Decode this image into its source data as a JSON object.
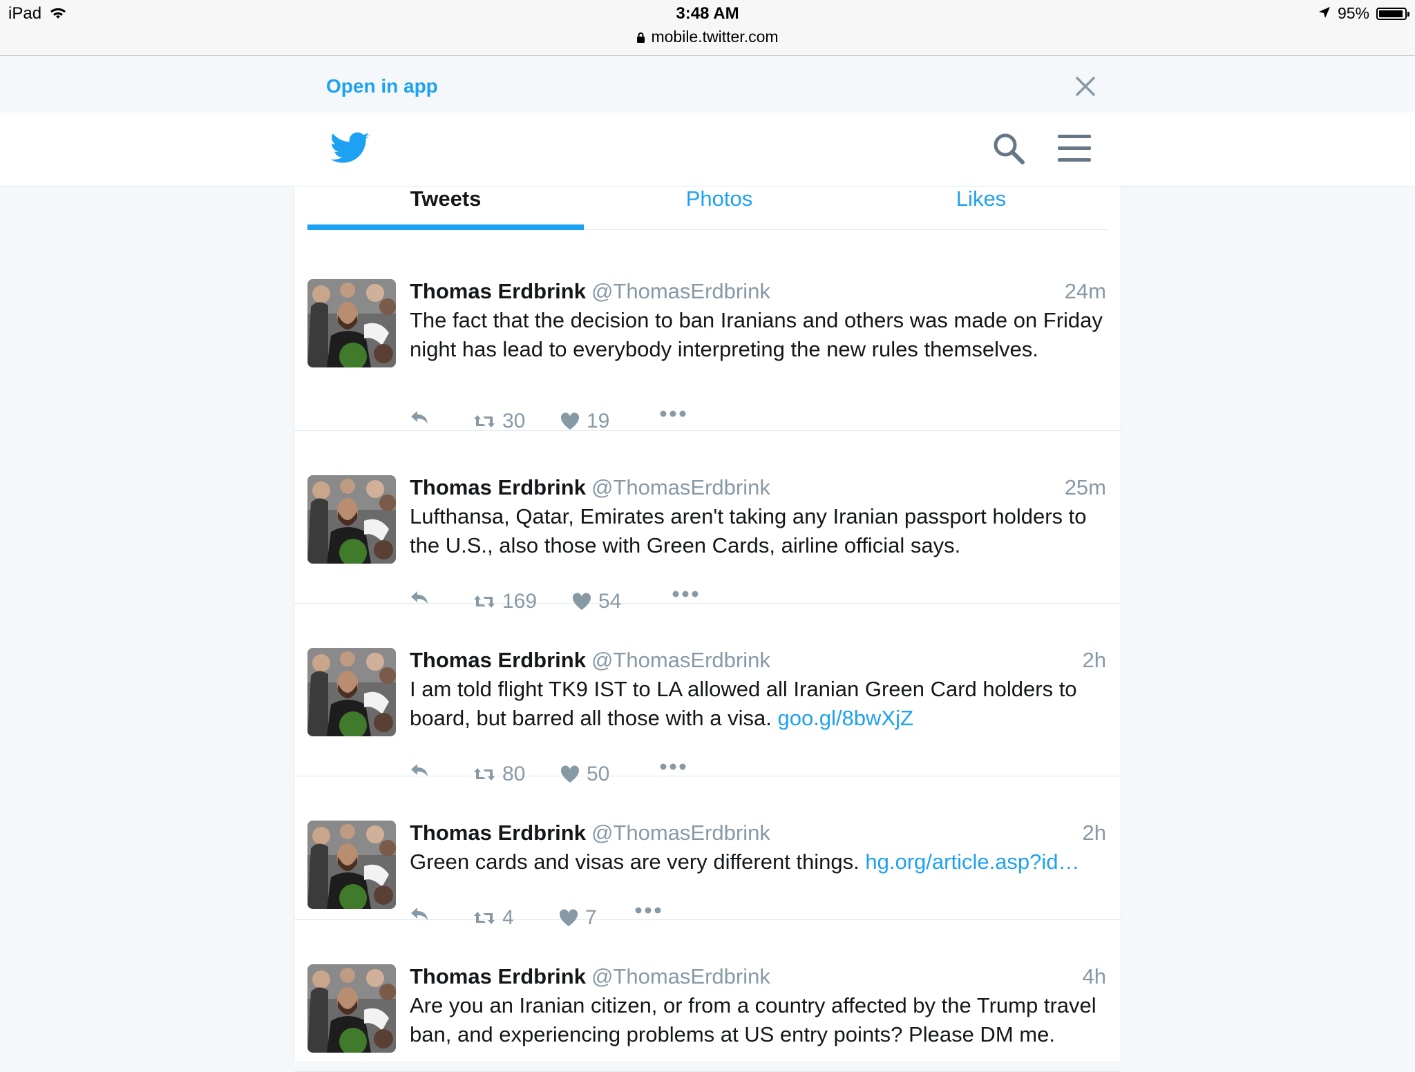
{
  "status_bar": {
    "device": "iPad",
    "time": "3:48 AM",
    "url": "mobile.twitter.com",
    "battery": "95%",
    "battery_level": 0.95
  },
  "banner": {
    "open_in_app": "Open in app"
  },
  "tabs": [
    {
      "label": "Tweets",
      "active": true
    },
    {
      "label": "Photos",
      "active": false
    },
    {
      "label": "Likes",
      "active": false
    }
  ],
  "tweets": [
    {
      "name": "Thomas Erdbrink",
      "handle": "@ThomasErdbrink",
      "time": "24m",
      "text": "The fact that the decision to ban Iranians and others was made on Friday night has lead to everybody interpreting the new rules themselves.",
      "link": "",
      "retweets": "30",
      "likes": "19"
    },
    {
      "name": "Thomas Erdbrink",
      "handle": "@ThomasErdbrink",
      "time": "25m",
      "text": "Lufthansa, Qatar, Emirates aren't taking any Iranian passport holders to the U.S., also those with Green Cards, airline official says.",
      "link": "",
      "retweets": "169",
      "likes": "54"
    },
    {
      "name": "Thomas Erdbrink",
      "handle": "@ThomasErdbrink",
      "time": "2h",
      "text": "I am told flight TK9 IST to LA allowed all Iranian Green Card holders to board, but barred all those with a visa. ",
      "link": "goo.gl/8bwXjZ",
      "retweets": "80",
      "likes": "50"
    },
    {
      "name": "Thomas Erdbrink",
      "handle": "@ThomasErdbrink",
      "time": "2h",
      "text": "Green cards and visas are very different things. ",
      "link": "hg.org/article.asp?id…",
      "retweets": "4",
      "likes": "7"
    },
    {
      "name": "Thomas Erdbrink",
      "handle": "@ThomasErdbrink",
      "time": "4h",
      "text": "Are you an Iranian citizen, or from a country affected by the Trump travel ban, and experiencing problems at US entry points? Please DM me.",
      "link": "",
      "retweets": "",
      "likes": ""
    }
  ],
  "colors": {
    "brand": "#1da1f2",
    "muted": "#8899a6",
    "text": "#14171a",
    "border": "#e1e8ed",
    "page_bg": "#f5f8fa"
  },
  "icons": [
    "wifi-icon",
    "lock-icon",
    "location-arrow-icon",
    "battery-icon",
    "close-icon",
    "twitter-bird-logo",
    "search-icon",
    "menu-icon",
    "reply-icon",
    "retweet-icon",
    "heart-icon",
    "more-icon"
  ]
}
